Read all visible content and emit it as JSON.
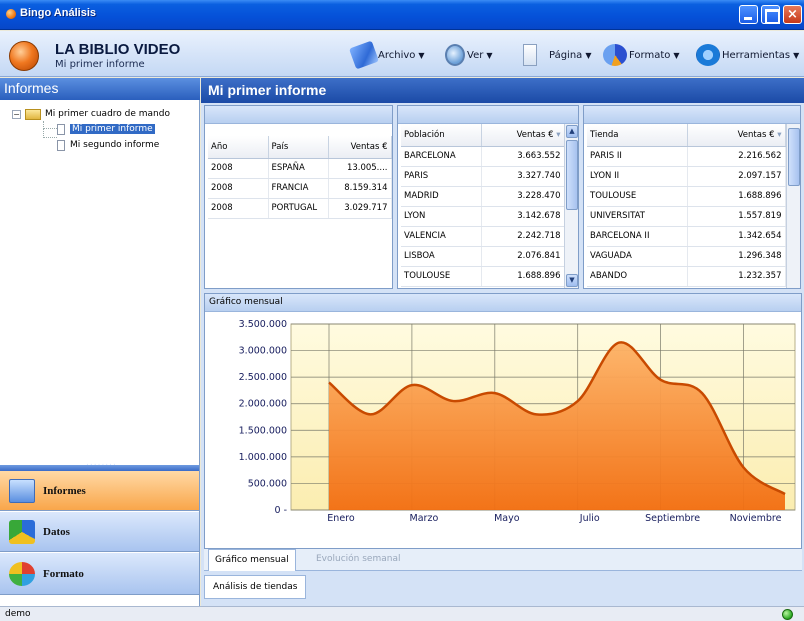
{
  "window": {
    "title": "Bingo Análisis"
  },
  "header": {
    "title": "LA BIBLIO VIDEO",
    "subtitle": "Mi primer informe"
  },
  "toolbar": {
    "items": [
      {
        "label": "Archivo",
        "icon": "archivo-icon"
      },
      {
        "label": "Ver",
        "icon": "magnifier-icon"
      },
      {
        "label": "Página",
        "icon": "page-icon"
      },
      {
        "label": "Formato",
        "icon": "palette-icon"
      },
      {
        "label": "Herramientas",
        "icon": "tools-icon"
      }
    ]
  },
  "sidebar": {
    "heading": "Informes",
    "tree": {
      "root": "Mi primer cuadro de mando",
      "children": [
        "Mi primer informe",
        "Mi segundo informe"
      ],
      "selected_index": 0
    },
    "nav": [
      {
        "label": "Informes",
        "icon": "informes-icon",
        "active": true
      },
      {
        "label": "Datos",
        "icon": "datos-icon",
        "active": false
      },
      {
        "label": "Formato",
        "icon": "formato-icon",
        "active": false
      }
    ]
  },
  "main": {
    "heading": "Mi primer informe",
    "table1": {
      "columns": [
        "Año",
        "País",
        "Ventas €"
      ],
      "rows": [
        [
          "2008",
          "ESPAÑA",
          "13.005...."
        ],
        [
          "2008",
          "FRANCIA",
          "8.159.314"
        ],
        [
          "2008",
          "PORTUGAL",
          "3.029.717"
        ]
      ]
    },
    "table2": {
      "columns": [
        "Población",
        "Ventas €"
      ],
      "rows": [
        [
          "BARCELONA",
          "3.663.552"
        ],
        [
          "PARIS",
          "3.327.740"
        ],
        [
          "MADRID",
          "3.228.470"
        ],
        [
          "LYON",
          "3.142.678"
        ],
        [
          "VALENCIA",
          "2.242.718"
        ],
        [
          "LISBOA",
          "2.076.841"
        ],
        [
          "TOULOUSE",
          "1.688.896"
        ]
      ]
    },
    "table3": {
      "columns": [
        "Tienda",
        "Ventas €"
      ],
      "rows": [
        [
          "PARIS II",
          "2.216.562"
        ],
        [
          "LYON II",
          "2.097.157"
        ],
        [
          "TOULOUSE",
          "1.688.896"
        ],
        [
          "UNIVERSITAT",
          "1.557.819"
        ],
        [
          "BARCELONA II",
          "1.342.654"
        ],
        [
          "VAGUADA",
          "1.296.348"
        ],
        [
          "ABANDO",
          "1.232.357"
        ]
      ]
    },
    "chart_title": "Gráfico mensual",
    "tabs": [
      {
        "label": "Gráfico mensual",
        "active": true
      },
      {
        "label": "Evolución semanal",
        "active": false
      }
    ],
    "bottom_tab": "Análisis de tiendas"
  },
  "status": {
    "text": "demo"
  },
  "colors": {
    "titlebar": "#0550d8",
    "area_fill_top": "#fdb266",
    "area_fill_bottom": "#f26d10",
    "area_line": "#c84a00",
    "plot_bg": "#fff8c8",
    "active_nav": "#f9a64a"
  },
  "chart_data": {
    "type": "area",
    "title": "",
    "xlabel": "",
    "ylabel": "",
    "ylim": [
      0,
      3500000
    ],
    "yticks": [
      "3.500.000",
      "3.000.000",
      "2.500.000",
      "2.000.000",
      "1.500.000",
      "1.000.000",
      "500.000",
      "0"
    ],
    "xticks": [
      "Enero",
      "Marzo",
      "Mayo",
      "Julio",
      "Septiembre",
      "Noviembre"
    ],
    "x": [
      1,
      2,
      3,
      4,
      5,
      6,
      7,
      8,
      9,
      10,
      11,
      12
    ],
    "values": [
      2400000,
      1800000,
      2350000,
      2050000,
      2200000,
      1800000,
      2050000,
      3150000,
      2450000,
      2200000,
      800000,
      300000
    ],
    "grid": true,
    "legend": "none"
  }
}
